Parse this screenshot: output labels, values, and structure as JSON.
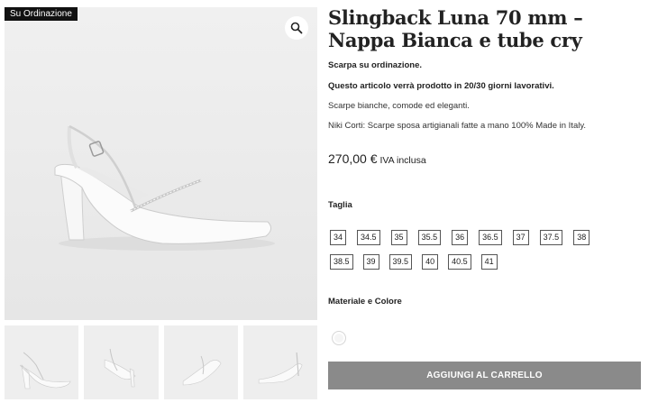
{
  "gallery": {
    "badge": "Su Ordinazione",
    "zoom_icon": "magnifier-icon",
    "thumbnail_count": 4
  },
  "product": {
    "title": "Slingback Luna 70 mm – Nappa Bianca e tube cry",
    "order_note": "Scarpa su ordinazione.",
    "production_note": "Questo articolo verrà prodotto in 20/30 giorni lavorativi.",
    "short_desc": "Scarpe bianche, comode ed eleganti.",
    "brand_desc": "Niki Corti: Scarpe sposa artigianali fatte a mano 100% Made in Italy.",
    "price": "270,00 €",
    "vat": "IVA inclusa"
  },
  "options": {
    "size_label": "Taglia",
    "sizes_row1": [
      "34",
      "34.5",
      "35",
      "35.5",
      "36",
      "36.5",
      "37",
      "37.5",
      "38"
    ],
    "sizes_row2": [
      "38.5",
      "39",
      "39.5",
      "40",
      "40.5",
      "41"
    ],
    "material_label": "Materiale e Colore",
    "swatch_color": "#f5f5f5"
  },
  "cart": {
    "button_label": "AGGIUNGI AL CARRELLO"
  },
  "colors": {
    "badge_bg": "#111111",
    "button_bg": "#8a8a8a",
    "image_bg": "#eeeeee"
  }
}
